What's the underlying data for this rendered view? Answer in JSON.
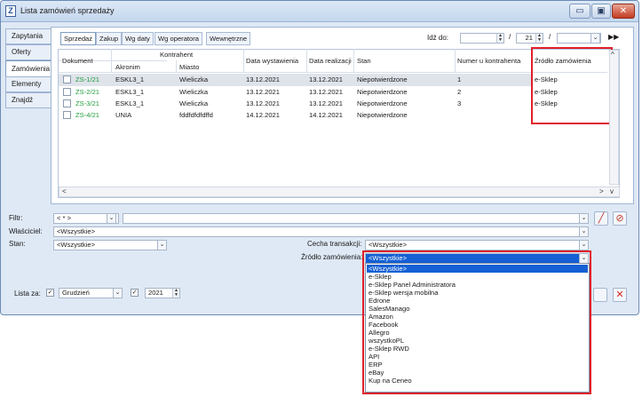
{
  "window": {
    "icon": "Z",
    "title": "Lista zamówień sprzedaży",
    "buttons": {
      "minimize": "▭",
      "maximize": "▣",
      "close": "✕"
    }
  },
  "side_tabs": [
    "Zapytania",
    "Oferty",
    "Zamówienia",
    "Elementy",
    "Znajdź"
  ],
  "top_tabs": [
    "Sprzedaż",
    "Zakup",
    "Wg daty",
    "Wg operatora",
    "Wewnętrzne"
  ],
  "date_filter": {
    "label": "Idź do:",
    "day": "21",
    "separator": "/",
    "nav_icon": "▶▶"
  },
  "table": {
    "headers": {
      "dokument": "Dokument",
      "kontrahent": "Kontrahent",
      "akronim": "Akronim",
      "miasto": "Miasto",
      "data_wystawienia": "Data wystawienia",
      "data_realizacji": "Data realizacji",
      "stan": "Stan",
      "numer": "Numer u kontrahenta",
      "zrodlo": "Źródło zamówienia"
    },
    "rows": [
      {
        "doc": "ZS-1/21",
        "akronim": "ESKL3_1",
        "miasto": "Wieliczka",
        "wyst": "13.12.2021",
        "real": "13.12.2021",
        "stan": "Niepotwierdzone",
        "numer": "1",
        "zrodlo": "e-Sklep"
      },
      {
        "doc": "ZS-2/21",
        "akronim": "ESKL3_1",
        "miasto": "Wieliczka",
        "wyst": "13.12.2021",
        "real": "13.12.2021",
        "stan": "Niepotwierdzone",
        "numer": "2",
        "zrodlo": "e-Sklep"
      },
      {
        "doc": "ZS-3/21",
        "akronim": "ESKL3_1",
        "miasto": "Wieliczka",
        "wyst": "13.12.2021",
        "real": "13.12.2021",
        "stan": "Niepotwierdzone",
        "numer": "3",
        "zrodlo": "e-Sklep"
      },
      {
        "doc": "ZS-4/21",
        "akronim": "UNIA",
        "miasto": "fddfdfdfdffd",
        "wyst": "14.12.2021",
        "real": "14.12.2021",
        "stan": "Niepotwierdzone",
        "numer": "",
        "zrodlo": ""
      }
    ]
  },
  "filters": {
    "filtr_label": "Filtr:",
    "filtr_value": "< * >",
    "wlasciciel_label": "Właściciel:",
    "wlasciciel_value": "<Wszystkie>",
    "stan_label": "Stan:",
    "stan_value": "<Wszystkie>",
    "cecha_label": "Cecha transakcji:",
    "cecha_value": "<Wszystkie>",
    "zrodlo_label": "Źródło zamówienia:",
    "zrodlo_value": "<Wszystkie>",
    "lista_label": "Lista za:",
    "month_value": "Grudzień",
    "year_value": "2021"
  },
  "dropdown_options": [
    "<Wszystkie>",
    "e-Sklep",
    "e-Sklep Panel Administratora",
    "e-Sklep wersja mobilna",
    "Edrone",
    "SalesManago",
    "Amazon",
    "Facebook",
    "Allegro",
    "wszystkoPL",
    "e-Sklep RWD",
    "API",
    "ERP",
    "eBay",
    "Kup na Ceneo"
  ],
  "colors": {
    "highlight": "#e0202a",
    "doc_link": "#1f9d3a",
    "selected_option": "#1560d4"
  }
}
